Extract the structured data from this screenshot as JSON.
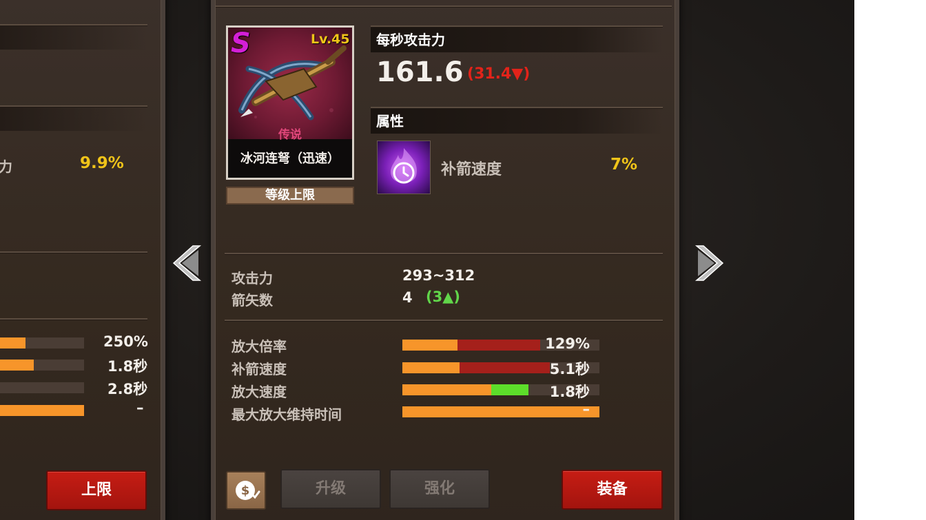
{
  "left_panel": {
    "stat_label_fragment": "力",
    "stat_value": "9.9%",
    "bar_values": [
      "250%",
      "1.8秒",
      "2.8秒",
      "–"
    ],
    "bar_levels": [
      {
        "orange": 0.3
      },
      {
        "orange": 0.4
      },
      {
        "orange": 0.0
      },
      {
        "orange": 1.0
      }
    ],
    "button_label": "上限"
  },
  "item": {
    "rank_letter": "S",
    "level": "Lv.45",
    "rarity": "传说",
    "name": "冰河连弩（迅速）",
    "level_cap_label": "等级上限"
  },
  "dps": {
    "header": "每秒攻击力",
    "value": "161.6",
    "change_open": "(",
    "change_value": "31.4",
    "change_close": ")",
    "change_direction": "down"
  },
  "attribute": {
    "header": "属性",
    "name": "补箭速度",
    "value": "7%",
    "icon": "purple-flame-clock-icon"
  },
  "base_stats": [
    {
      "label": "攻击力",
      "value": "293~312"
    },
    {
      "label": "箭矢数",
      "value": "4",
      "bonus_open": "(",
      "bonus": "3",
      "bonus_close": ")",
      "bonus_direction": "up"
    }
  ],
  "bar_stats": [
    {
      "label": "放大倍率",
      "value": "129%",
      "orange": 0.28,
      "red": 0.42,
      "green": 0
    },
    {
      "label": "补箭速度",
      "value": "5.1秒",
      "orange": 0.29,
      "red": 0.46,
      "green": 0
    },
    {
      "label": "放大速度",
      "value": "1.8秒",
      "orange": 0.45,
      "red": 0,
      "green": 0.19
    },
    {
      "label": "最大放大维持时间",
      "value": "–",
      "orange": 1.0,
      "red": 0,
      "green": 0
    }
  ],
  "actions": {
    "coin_icon": "coin-refund-icon",
    "upgrade_label": "升级",
    "enhance_label": "强化",
    "equip_label": "装备"
  },
  "colors": {
    "gold": "#f0c419",
    "red_down": "#e2231a",
    "green_up": "#61d64a",
    "bar_orange": "#f7952a",
    "bar_red": "#a5201b",
    "bar_green": "#5dde2a",
    "button_red": "#c61d14"
  }
}
